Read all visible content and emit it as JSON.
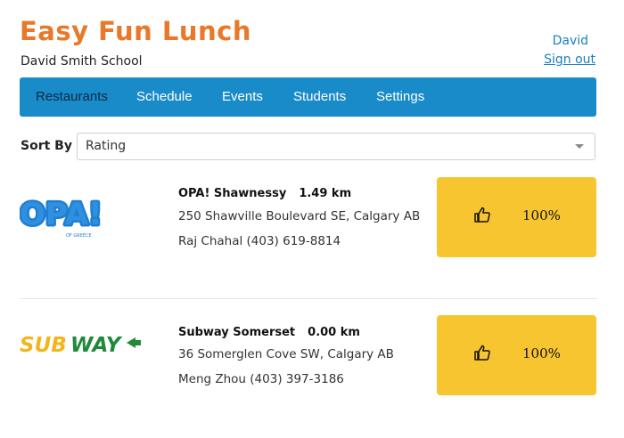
{
  "app": {
    "title": "Easy Fun Lunch",
    "school": "David Smith School"
  },
  "user": {
    "name": "David",
    "signout_label": "Sign out"
  },
  "nav": {
    "items": [
      {
        "label": "Restaurants",
        "active": true
      },
      {
        "label": "Schedule",
        "active": false
      },
      {
        "label": "Events",
        "active": false
      },
      {
        "label": "Students",
        "active": false
      },
      {
        "label": "Settings",
        "active": false
      }
    ]
  },
  "sort": {
    "label": "Sort By",
    "value": "Rating"
  },
  "restaurants": [
    {
      "name": "OPA! Shawnessy",
      "distance": "1.49 km",
      "address": "250 Shawville Boulevard SE, Calgary AB",
      "contact": "Raj Chahal (403) 619-8814",
      "rating": "100%",
      "logo_text": "OPA!",
      "logo_sub": "OF GREECE",
      "logo_color": "#1f7fd1"
    },
    {
      "name": "Subway Somerset",
      "distance": "0.00 km",
      "address": "36 Somerglen Cove SW, Calgary AB",
      "contact": "Meng Zhou (403) 397-3186",
      "rating": "100%",
      "logo_text_1": "SUB",
      "logo_text_2": "WAY",
      "logo_color_1": "#f2b51c",
      "logo_color_2": "#1e8a3a"
    }
  ],
  "colors": {
    "brand": "#e8782a",
    "nav": "#1a8bc9",
    "rating_box": "#f7c530",
    "link": "#1a7fc0"
  }
}
